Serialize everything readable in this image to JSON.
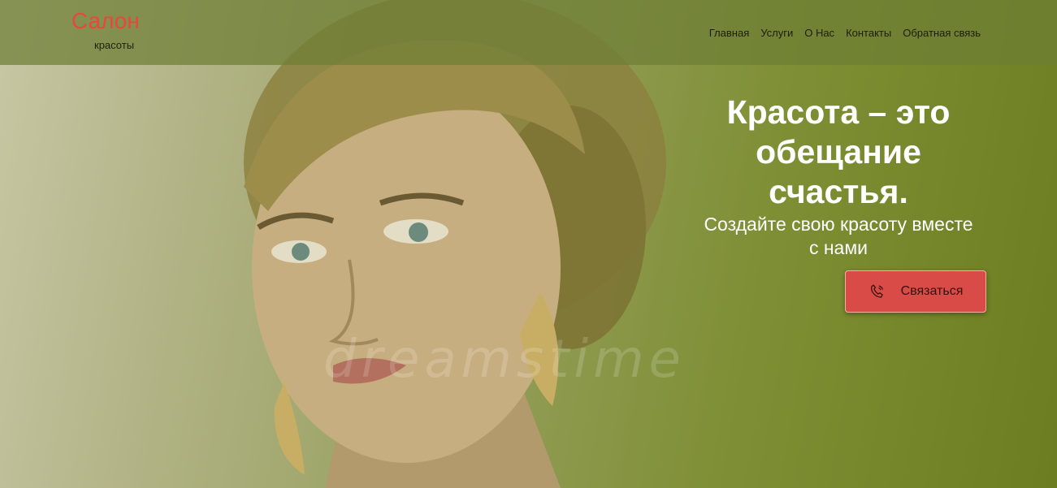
{
  "header": {
    "logo_title": "Салон",
    "logo_subtitle": "красоты",
    "nav": [
      {
        "label": "Главная"
      },
      {
        "label": "Услуги"
      },
      {
        "label": "О Нас"
      },
      {
        "label": "Контакты"
      },
      {
        "label": "Обратная связь"
      }
    ]
  },
  "hero": {
    "headline": "Красота – это обещание счастья.",
    "subline": "Создайте свою красоту вместе с нами",
    "cta_label": "Связаться",
    "cta_icon": "phone-icon",
    "watermark": "dreamstime"
  },
  "colors": {
    "accent": "#d84b46",
    "logo": "#e8473d",
    "header_bg": "#6e7e34",
    "hero_dark": "#6c7c20"
  }
}
